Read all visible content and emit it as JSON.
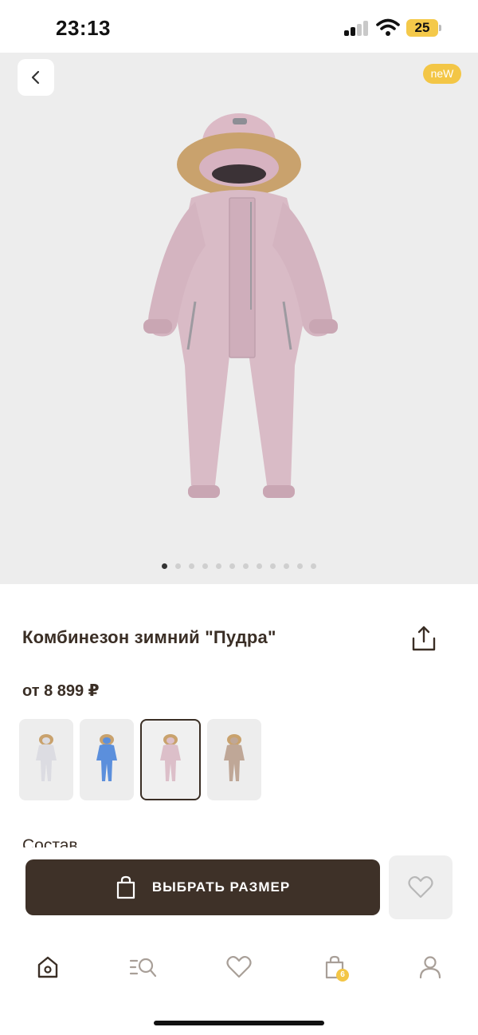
{
  "status_bar": {
    "time": "23:13",
    "battery": "25"
  },
  "colors": {
    "accent": "#f3c646",
    "primary": "#3e3128",
    "text": "#3a2e25",
    "hero_bg": "#ededed"
  },
  "hero": {
    "badge": "neW",
    "slide_count": 12,
    "active_slide": 1
  },
  "product": {
    "title": "Комбинезон зимний \"Пудра\"",
    "price": "от 8 899 ₽"
  },
  "variants": [
    {
      "color_name": "light-gray",
      "body": "#dcdce2",
      "selected": false
    },
    {
      "color_name": "blue",
      "body": "#5b8fdc",
      "selected": false
    },
    {
      "color_name": "pink",
      "body": "#dcbfc9",
      "selected": true
    },
    {
      "color_name": "beige",
      "body": "#bfa797",
      "selected": false
    }
  ],
  "section": {
    "label": "Состав"
  },
  "actions": {
    "select_size_label": "ВЫБРАТЬ РАЗМЕР"
  },
  "tab_bar": {
    "items": [
      {
        "name": "home",
        "icon": "home-icon",
        "active": true
      },
      {
        "name": "catalog",
        "icon": "catalog-search-icon",
        "active": false
      },
      {
        "name": "favorites",
        "icon": "heart-icon",
        "active": false
      },
      {
        "name": "cart",
        "icon": "bag-icon",
        "active": false
      },
      {
        "name": "profile",
        "icon": "user-icon",
        "active": false
      }
    ],
    "cart_count": "6"
  }
}
